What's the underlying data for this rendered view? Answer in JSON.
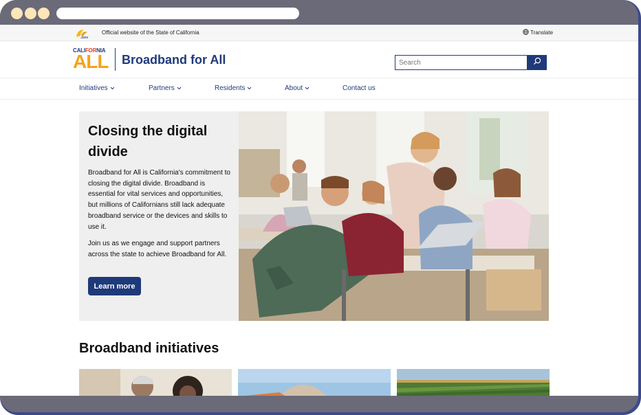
{
  "utility": {
    "official_text": "Official website of the State of California",
    "translate_label": "Translate",
    "translate_icon": "globe-icon",
    "ca_gov_logo_text": ".GOV"
  },
  "brand": {
    "logo_top_parts": [
      "CALI",
      "FOR",
      "NIA"
    ],
    "logo_main": "ALL",
    "site_title": "Broadband for All",
    "colors": {
      "navy": "#1f3a7a",
      "orange": "#f7a21b",
      "red": "#d9422b"
    }
  },
  "search": {
    "placeholder": "Search",
    "button_icon": "search-icon"
  },
  "nav": {
    "items": [
      {
        "label": "Initiatives",
        "has_dropdown": true
      },
      {
        "label": "Partners",
        "has_dropdown": true
      },
      {
        "label": "Residents",
        "has_dropdown": true
      },
      {
        "label": "About",
        "has_dropdown": true
      },
      {
        "label": "Contact us",
        "has_dropdown": false
      }
    ]
  },
  "hero": {
    "title": "Closing the digital divide",
    "paragraph1": "Broadband for All is California's commitment to closing the digital divide. Broadband is essential for vital services and opportunities, but millions of Californians still lack adequate broadband service or the devices and skills to use it.",
    "paragraph2": "Join us as we engage and support partners across the state to achieve Broadband for All.",
    "button_label": "Learn more"
  },
  "initiatives": {
    "section_title": "Broadband initiatives"
  }
}
